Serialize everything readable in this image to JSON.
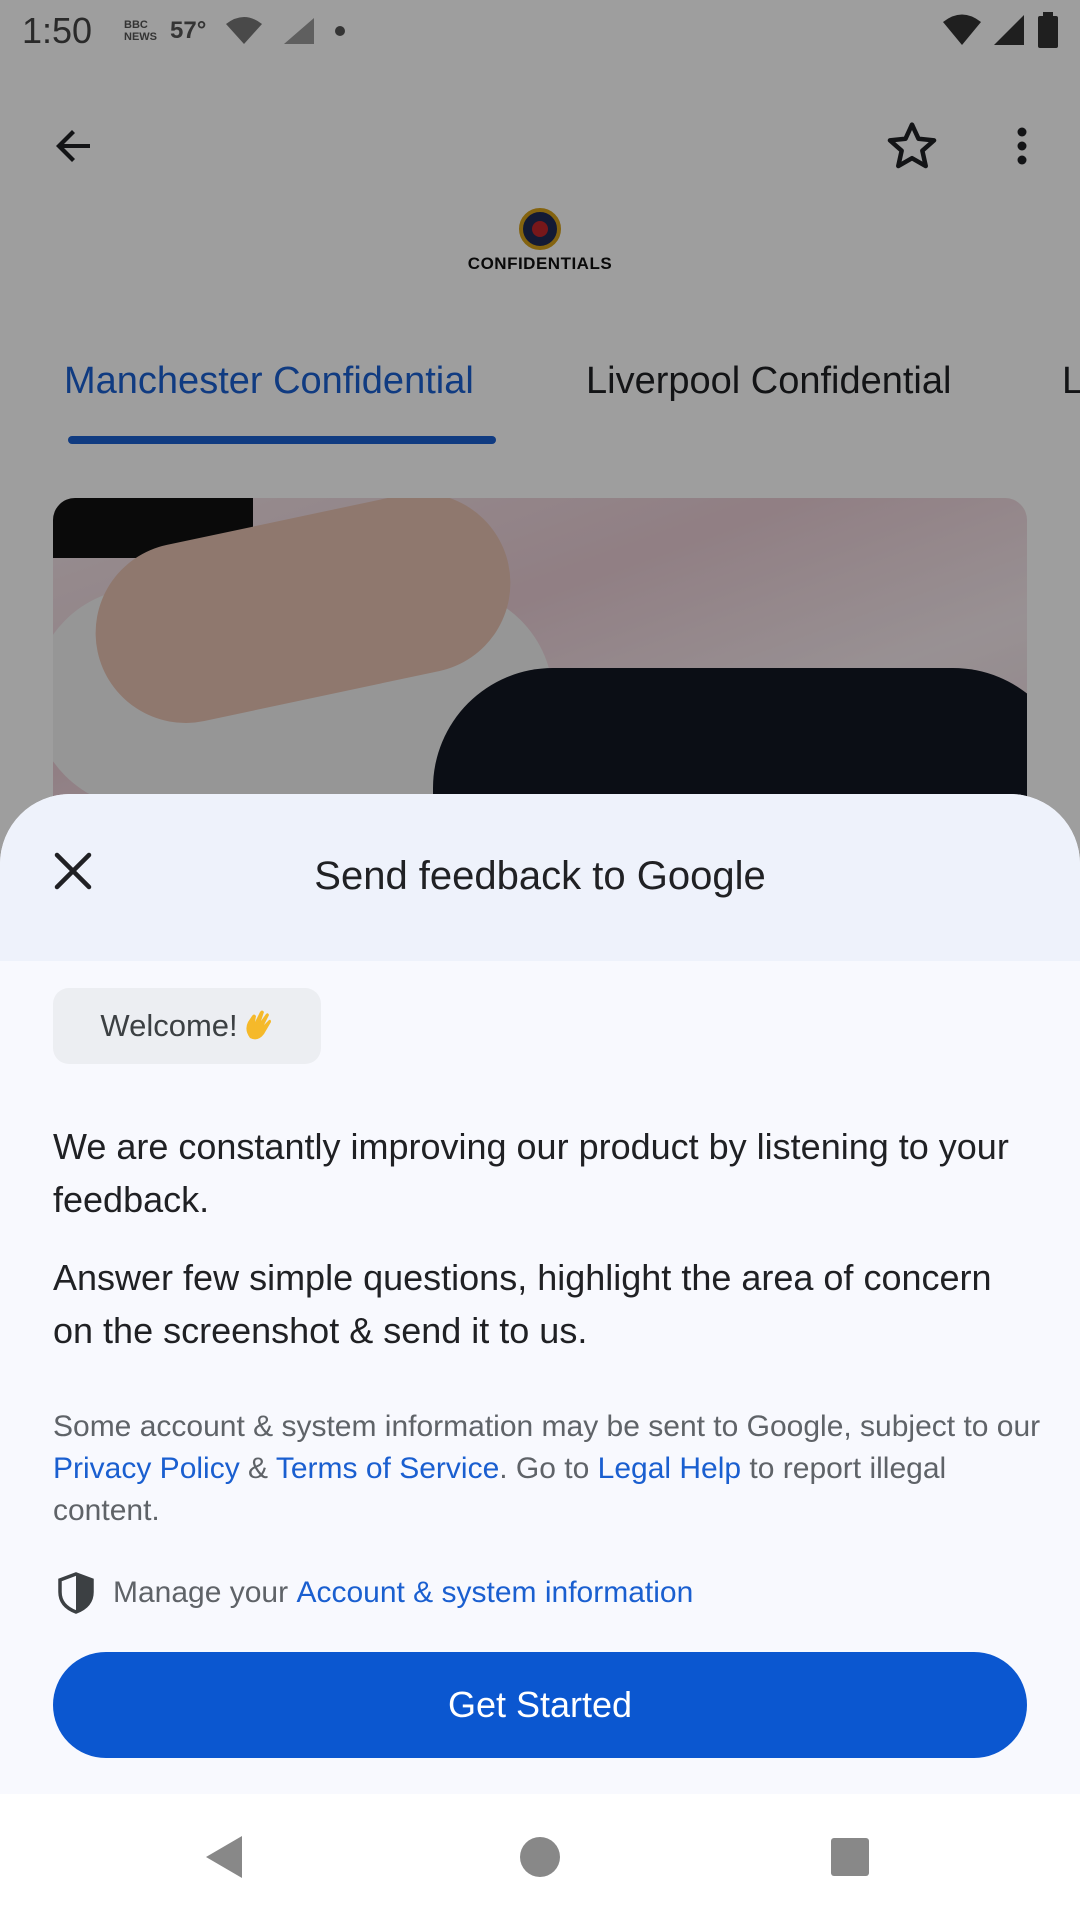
{
  "status_bar": {
    "time": "1:50",
    "news_label": "BBC NEWS",
    "temperature": "57°"
  },
  "app": {
    "brand": "CONFIDENTIALS",
    "tabs": [
      {
        "label": "Manchester Confidential",
        "selected": true
      },
      {
        "label": "Liverpool Confidential",
        "selected": false
      },
      {
        "label": "L",
        "selected": false
      }
    ]
  },
  "sheet": {
    "title": "Send feedback to Google",
    "welcome": "Welcome!",
    "paragraph_1": "We are constantly improving our product by listening to your feedback.",
    "paragraph_2": "Answer few simple questions, highlight the area of concern on the screenshot & send it to us.",
    "legal": {
      "prefix": "Some account & system information may be sent to Google, subject to our ",
      "privacy_link": "Privacy Policy",
      "amp": " & ",
      "terms_link": "Terms of Service",
      "go_to": ". Go to ",
      "legal_help_link": "Legal Help",
      "suffix": " to report illegal content."
    },
    "manage": {
      "prefix": "Manage your ",
      "link": "Account & system information"
    },
    "cta_label": "Get Started"
  },
  "colors": {
    "accent": "#1a5fd0",
    "cta": "#0b57d0",
    "sheet_bg": "#f8f9fe",
    "sheet_header_bg": "#eef2fb"
  },
  "icons": {
    "back": "arrow-left-icon",
    "favorite": "star-outline-icon",
    "more": "more-vert-icon",
    "close": "close-icon",
    "shield": "shield-icon",
    "wave": "waving-hand-icon"
  }
}
